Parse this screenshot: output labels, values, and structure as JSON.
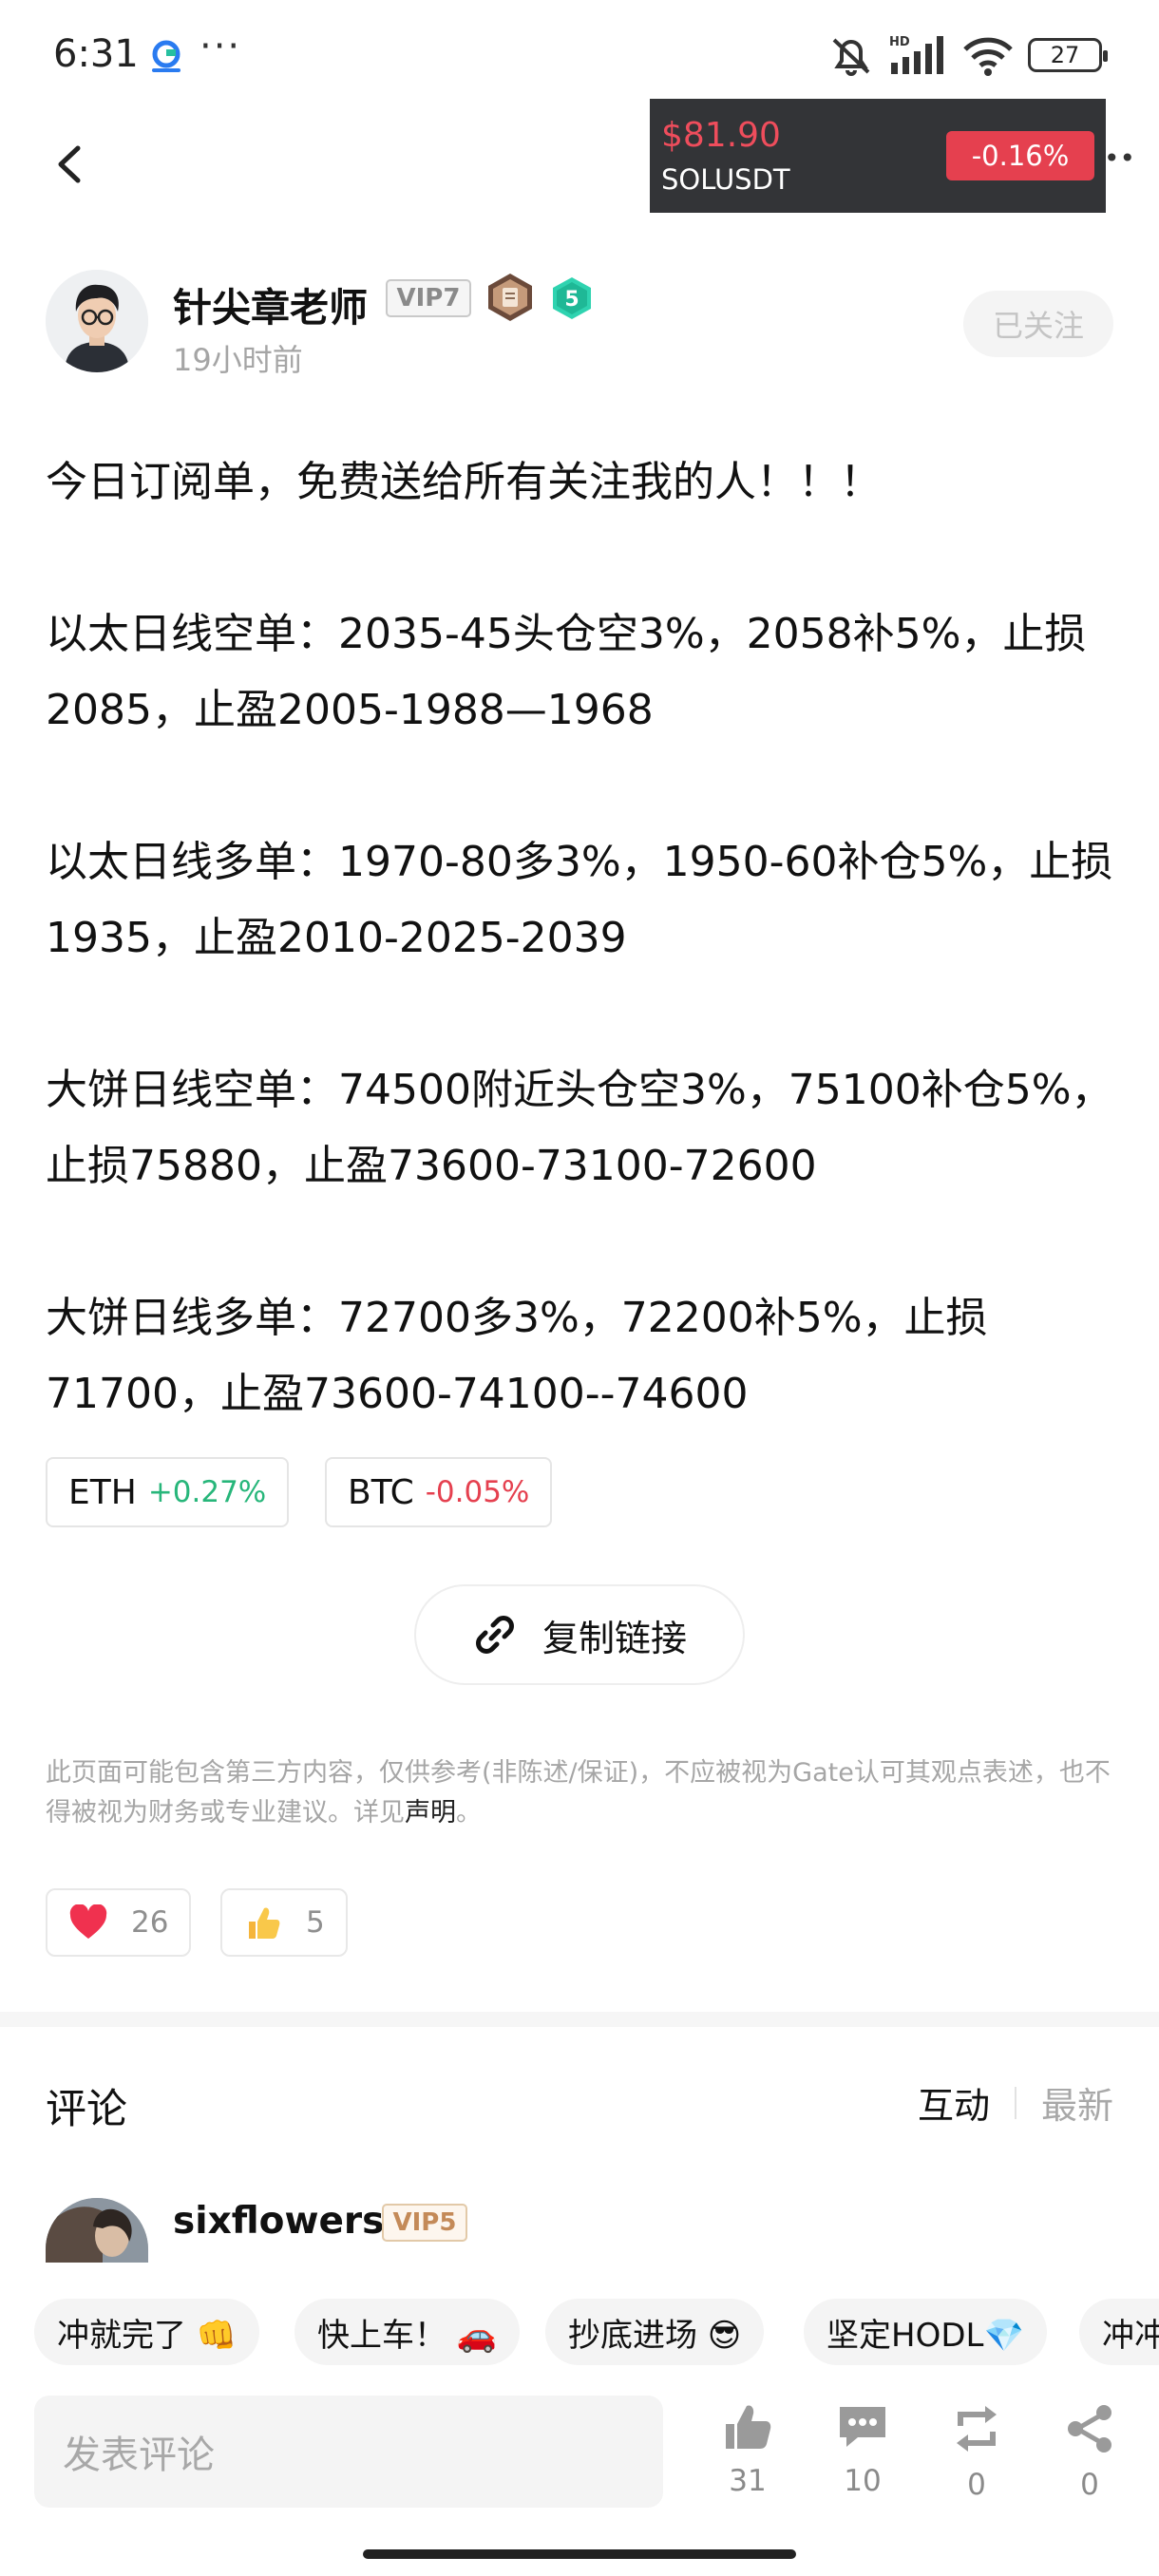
{
  "status_bar": {
    "time": "6:31",
    "dots": "···",
    "battery": "27",
    "network": "HD"
  },
  "ticker": {
    "price": "$81.90",
    "symbol": "SOLUSDT",
    "change": "-0.16%"
  },
  "author": {
    "name": "针尖章老师",
    "vip": "VIP7",
    "level": "5",
    "time": "19小时前",
    "follow_label": "已关注"
  },
  "post": {
    "paragraphs": [
      "今日订阅单，免费送给所有关注我的人！！！",
      "以太日线空单：2035-45头仓空3%，2058补5%，止损2085，止盈2005-1988—1968",
      "以太日线多单：1970-80多3%，1950-60补仓5%，止损1935，止盈2010-2025-2039",
      "大饼日线空单：74500附近头仓空3%，75100补仓5%，止损75880，止盈73600-73100-72600",
      "大饼日线多单：72700多3%，72200补5%，止损71700，止盈73600-74100--74600"
    ]
  },
  "coins": [
    {
      "symbol": "ETH",
      "change": "+0.27%",
      "color": "#27b67a"
    },
    {
      "symbol": "BTC",
      "change": "-0.05%",
      "color": "#e5404f"
    }
  ],
  "copy_link_label": "复制链接",
  "disclaimer": {
    "text": "此页面可能包含第三方内容，仅供参考(非陈述/保证)，不应被视为Gate认可其观点表述，也不得被视为财务或专业建议。详见",
    "link": "声明",
    "end": "。"
  },
  "reactions": [
    {
      "icon": "heart-icon",
      "count": "26"
    },
    {
      "icon": "thumbs-up-emoji-icon",
      "count": "5"
    }
  ],
  "comments": {
    "title": "评论",
    "sort_active": "互动",
    "sort_inactive": "最新",
    "first": {
      "name": "sixflowers",
      "vip": "VIP5"
    }
  },
  "quick_replies": [
    "冲就完了 👊",
    "快上车！ 🚗",
    "抄底进场 😎",
    "坚定HODL💎",
    "冲冲"
  ],
  "input_placeholder": "发表评论",
  "actions": [
    {
      "icon": "like-icon",
      "count": "31"
    },
    {
      "icon": "comment-icon",
      "count": "10"
    },
    {
      "icon": "repost-icon",
      "count": "0"
    },
    {
      "icon": "share-icon",
      "count": "0"
    }
  ],
  "colors": {
    "up": "#27b67a",
    "down": "#e5404f",
    "ticker_bg": "#333437"
  }
}
